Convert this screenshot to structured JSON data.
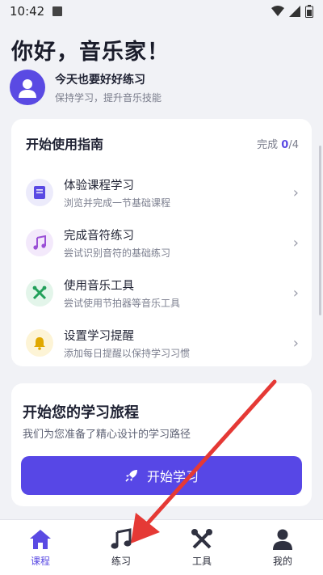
{
  "status_bar": {
    "time": "10:42"
  },
  "header": {
    "greeting": "你好，音乐家！",
    "title": "今天也要好好练习",
    "subtitle": "保持学习，提升音乐技能"
  },
  "guide": {
    "title": "开始使用指南",
    "progress_label": "完成",
    "progress_done": "0",
    "progress_total": "/4",
    "items": [
      {
        "title": "体验课程学习",
        "desc": "浏览并完成一节基础课程",
        "icon": "book-icon",
        "color": "#5a4ae3",
        "bg": "#ecebfb"
      },
      {
        "title": "完成音符练习",
        "desc": "尝试识别音符的基础练习",
        "icon": "music-note-icon",
        "color": "#9a4fd6",
        "bg": "#f3e9fb"
      },
      {
        "title": "使用音乐工具",
        "desc": "尝试使用节拍器等音乐工具",
        "icon": "tools-icon",
        "color": "#22a05a",
        "bg": "#e3f5ea"
      },
      {
        "title": "设置学习提醒",
        "desc": "添加每日提醒以保持学习习惯",
        "icon": "bell-icon",
        "color": "#e0a800",
        "bg": "#fdf4d6"
      }
    ]
  },
  "journey": {
    "title": "开始您的学习旅程",
    "subtitle": "我们为您准备了精心设计的学习路径",
    "button_label": "开始学习"
  },
  "tabs": [
    {
      "label": "课程",
      "icon": "home-icon",
      "active": true
    },
    {
      "label": "练习",
      "icon": "music-note-icon",
      "active": false
    },
    {
      "label": "工具",
      "icon": "tools-icon",
      "active": false
    },
    {
      "label": "我的",
      "icon": "person-icon",
      "active": false
    }
  ],
  "colors": {
    "accent": "#5a4ae3",
    "annotation_arrow": "#e53935"
  }
}
